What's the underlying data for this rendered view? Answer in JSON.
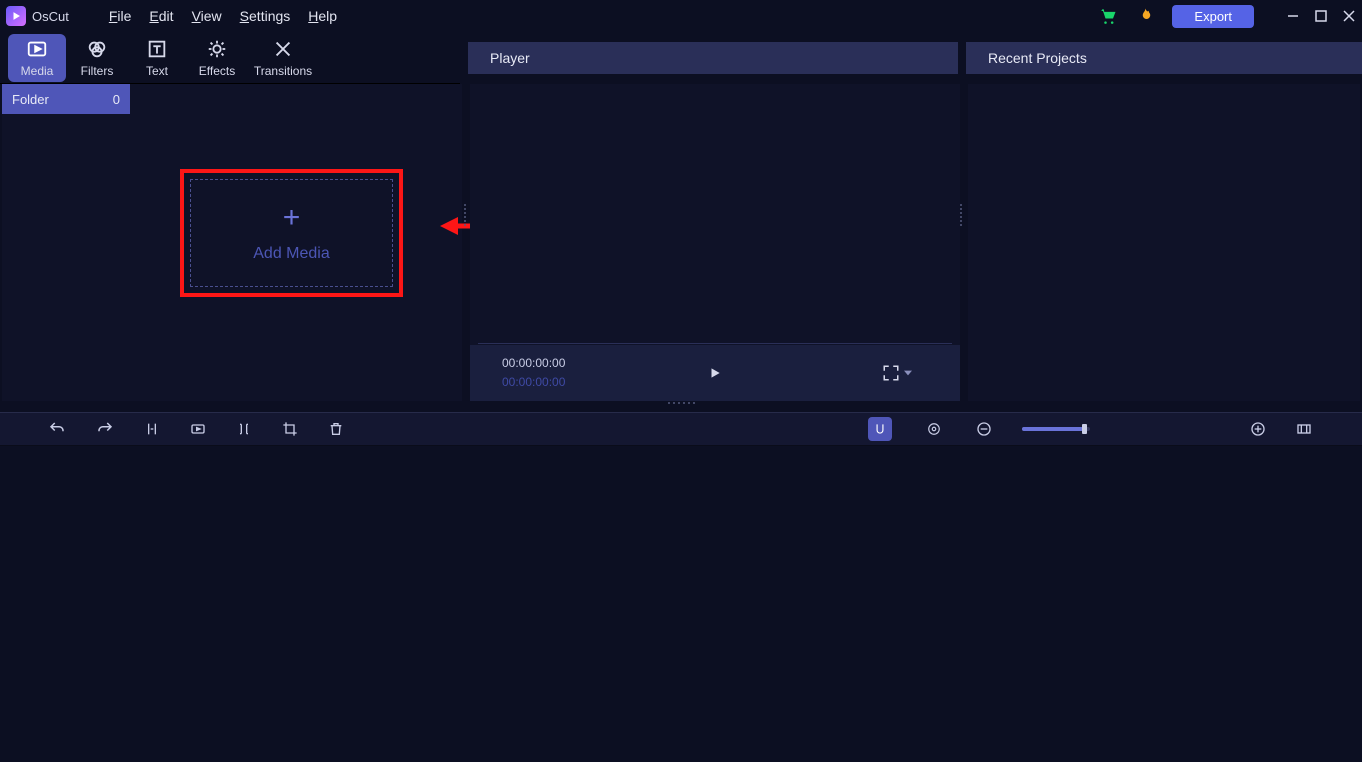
{
  "app": {
    "title": "OsCut"
  },
  "menu": {
    "file": "File",
    "edit": "Edit",
    "view": "View",
    "settings": "Settings",
    "help": "Help"
  },
  "toolbar": {
    "export": "Export"
  },
  "tabs": {
    "media": "Media",
    "filters": "Filters",
    "text": "Text",
    "effects": "Effects",
    "transitions": "Transitions"
  },
  "media": {
    "folder_label": "Folder",
    "folder_count": "0",
    "add_media": "Add Media"
  },
  "player": {
    "title": "Player",
    "time_current": "00:00:00:00",
    "time_total": "00:00:00:00"
  },
  "projects": {
    "title": "Recent Projects"
  }
}
